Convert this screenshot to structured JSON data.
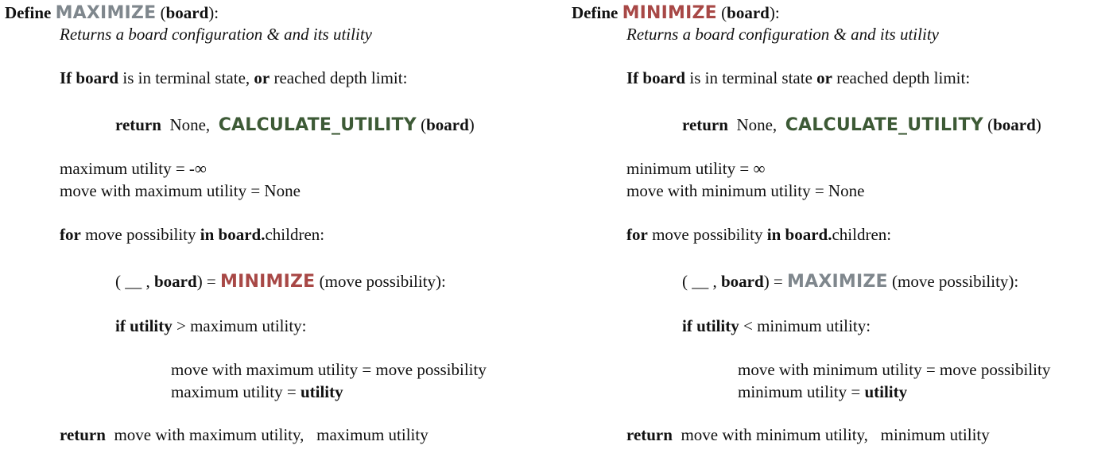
{
  "colors": {
    "maximize": "#7f878d",
    "minimize": "#a84846",
    "calculate_utility": "#3d5a36"
  },
  "left": {
    "define_kw": "Define",
    "fn_name": "MAXIMIZE",
    "param": "(board):",
    "param_open": "(",
    "param_name": "board",
    "param_close": "):",
    "comment": "Returns a board configuration & and its utility",
    "if_kw": "If",
    "board_kw": "board",
    "terminal_mid": " is in terminal state, ",
    "or_kw": "or",
    "terminal_end": " reached depth limit:",
    "return_kw": "return",
    "none_text": "  None,  ",
    "calc_fn": "CALCULATE_UTILITY",
    "calc_open": " (",
    "calc_board": "board",
    "calc_close": ")",
    "util_init": "maximum utility = -∞",
    "move_init": "move with maximum utility = None",
    "for_kw": "for",
    "for_mid": " move possibility ",
    "in_kw": "in",
    "for_board": " board.",
    "for_end": "children:",
    "tuple_open": "( __ , ",
    "tuple_board": "board",
    "tuple_eq": ") = ",
    "call_fn": "MINIMIZE",
    "call_args": " (move possibility):",
    "if2_kw": "if",
    "utility_kw": " utility",
    "compare": " > maximum utility:",
    "assign_move": "move with maximum utility = move possibility",
    "assign_util": "maximum utility = ",
    "assign_util_val": "utility",
    "final_return_kw": "return",
    "final_return_text": "  move with maximum utility,   maximum utility"
  },
  "right": {
    "define_kw": "Define",
    "fn_name": "MINIMIZE",
    "param_open": "(",
    "param_name": "board",
    "param_close": "):",
    "comment": "Returns a board configuration & and its utility",
    "if_kw": "If",
    "board_kw": "board",
    "terminal_mid": " is in terminal state ",
    "or_kw": "or",
    "terminal_end": " reached depth limit:",
    "return_kw": "return",
    "none_text": "  None,  ",
    "calc_fn": "CALCULATE_UTILITY",
    "calc_open": " (",
    "calc_board": "board",
    "calc_close": ")",
    "util_init": "minimum utility = ∞",
    "move_init": "move with minimum utility = None",
    "for_kw": "for",
    "for_mid": " move possibility ",
    "in_kw": "in",
    "for_board": " board.",
    "for_end": "children:",
    "tuple_open": "( __ , ",
    "tuple_board": "board",
    "tuple_eq": ") = ",
    "call_fn": "MAXIMIZE",
    "call_args": " (move possibility):",
    "if2_kw": "if",
    "utility_kw": " utility",
    "compare": " < minimum utility:",
    "assign_move": "move with minimum utility = move possibility",
    "assign_util": "minimum utility = ",
    "assign_util_val": "utility",
    "final_return_kw": "return",
    "final_return_text": "  move with minimum utility,   minimum utility"
  }
}
